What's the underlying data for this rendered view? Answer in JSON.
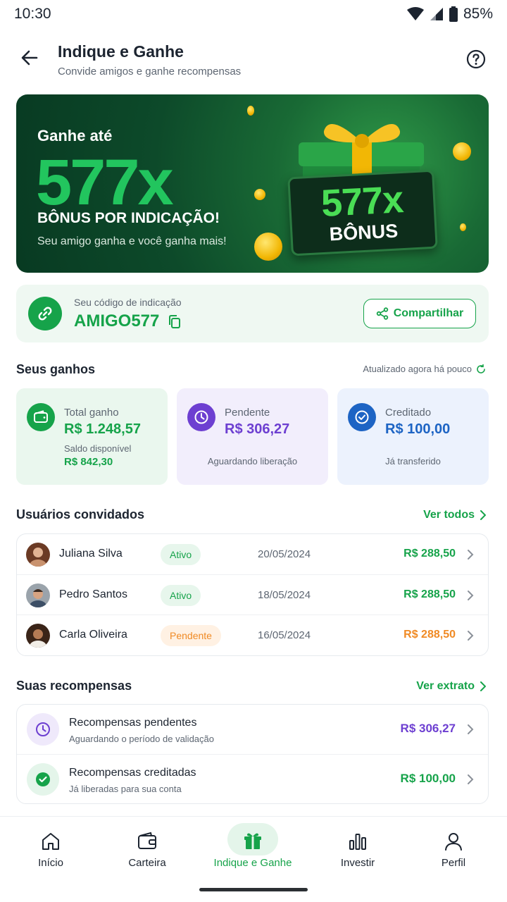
{
  "status_bar": {
    "time": "10:30",
    "battery": "85%"
  },
  "header": {
    "title": "Indique e Ganhe",
    "subtitle": "Convide amigos e ganhe recompensas",
    "back_icon": "arrow-left-icon",
    "help_icon": "help-circle-icon"
  },
  "banner": {
    "pre": "Ganhe até",
    "big": "577x",
    "bonus_line": "BÔNUS POR INDICAÇÃO!",
    "sub": "Seu amigo ganha e você ganha mais!",
    "ticket_big": "577x",
    "ticket_label": "BÔNUS"
  },
  "referral": {
    "label": "Seu código de indicação",
    "code": "AMIGO577",
    "share_label": "Compartilhar"
  },
  "earnings": {
    "title": "Seus ganhos",
    "updated": "Atualizado agora há pouco",
    "cards": [
      {
        "label": "Total ganho",
        "value": "R$ 1.248,57",
        "sub": "Saldo disponível",
        "sub_value": "R$ 842,30"
      },
      {
        "label": "Pendente",
        "value": "R$ 306,27",
        "sub": "Aguardando liberação"
      },
      {
        "label": "Creditado",
        "value": "R$ 100,00",
        "sub": "Já transferido"
      }
    ]
  },
  "users": {
    "title": "Usuários convidados",
    "see_all": "Ver todos",
    "rows": [
      {
        "name": "Juliana Silva",
        "status": "Ativo",
        "date": "20/05/2024",
        "value": "R$ 288,50"
      },
      {
        "name": "Pedro Santos",
        "status": "Ativo",
        "date": "18/05/2024",
        "value": "R$ 288,50"
      },
      {
        "name": "Carla Oliveira",
        "status": "Pendente",
        "date": "16/05/2024",
        "value": "R$ 288,50"
      }
    ]
  },
  "rewards": {
    "title": "Suas recompensas",
    "link": "Ver extrato",
    "rows": [
      {
        "title": "Recompensas pendentes",
        "sub": "Aguardando o período de validação",
        "value": "R$ 306,27"
      },
      {
        "title": "Recompensas creditadas",
        "sub": "Já liberadas para sua conta",
        "value": "R$ 100,00"
      }
    ]
  },
  "nav": [
    {
      "label": "Início",
      "icon": "home-icon"
    },
    {
      "label": "Carteira",
      "icon": "wallet-icon"
    },
    {
      "label": "Indique e Ganhe",
      "icon": "gift-icon"
    },
    {
      "label": "Investir",
      "icon": "bar-chart-icon"
    },
    {
      "label": "Perfil",
      "icon": "user-icon"
    }
  ],
  "colors": {
    "brand": "#16a34a",
    "purple": "#6d3fd1",
    "blue": "#1d64c4",
    "orange": "#f08a24"
  }
}
